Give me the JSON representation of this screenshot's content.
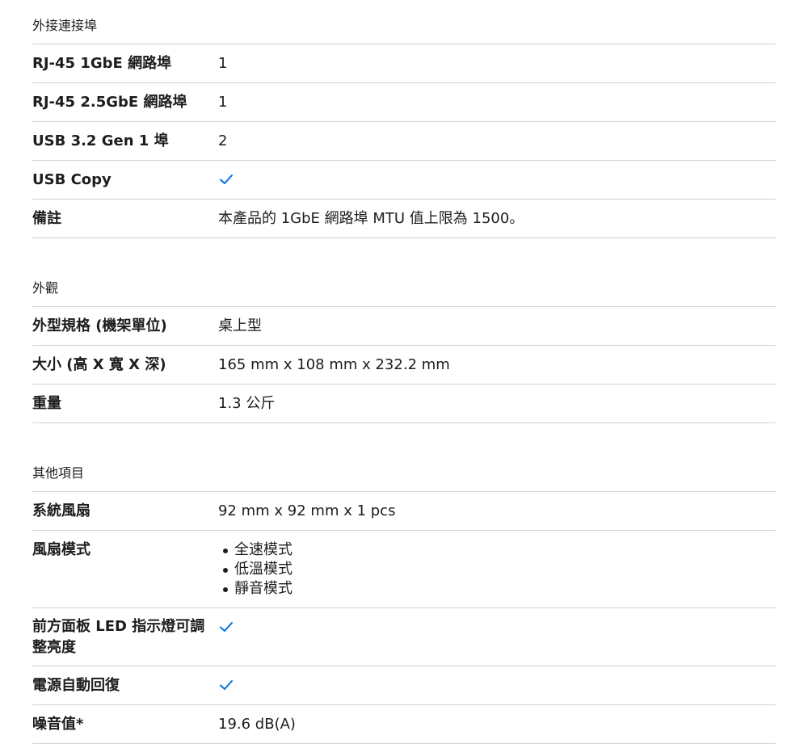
{
  "sections": [
    {
      "title": "外接連接埠",
      "rows": [
        {
          "label": "RJ-45 1GbE 網路埠",
          "value": "1"
        },
        {
          "label": "RJ-45 2.5GbE 網路埠",
          "value": "1"
        },
        {
          "label": "USB 3.2 Gen 1 埠",
          "value": "2"
        },
        {
          "label": "USB Copy",
          "value": "check"
        },
        {
          "label": "備註",
          "value": "本產品的 1GbE 網路埠 MTU 值上限為 1500。"
        }
      ]
    },
    {
      "title": "外觀",
      "rows": [
        {
          "label": "外型規格 (機架單位)",
          "value": "桌上型"
        },
        {
          "label": "大小 (高 X 寬 X 深)",
          "value": "165 mm x 108 mm x 232.2 mm"
        },
        {
          "label": "重量",
          "value": "1.3 公斤"
        }
      ]
    },
    {
      "title": "其他項目",
      "rows": [
        {
          "label": "系統風扇",
          "value": "92 mm x 92 mm x 1 pcs"
        },
        {
          "label": "風扇模式",
          "list": [
            "全速模式",
            "低溫模式",
            "靜音模式"
          ]
        },
        {
          "label": "前方面板 LED 指示燈可調整亮度",
          "value": "check"
        },
        {
          "label": "電源自動回復",
          "value": "check"
        },
        {
          "label": "噪音值*",
          "value": "19.6 dB(A)"
        }
      ]
    }
  ],
  "icons": {
    "check": "check-icon"
  },
  "colors": {
    "check": "#0071e3",
    "divider": "#d2d2d7",
    "text": "#1d1d1f"
  }
}
